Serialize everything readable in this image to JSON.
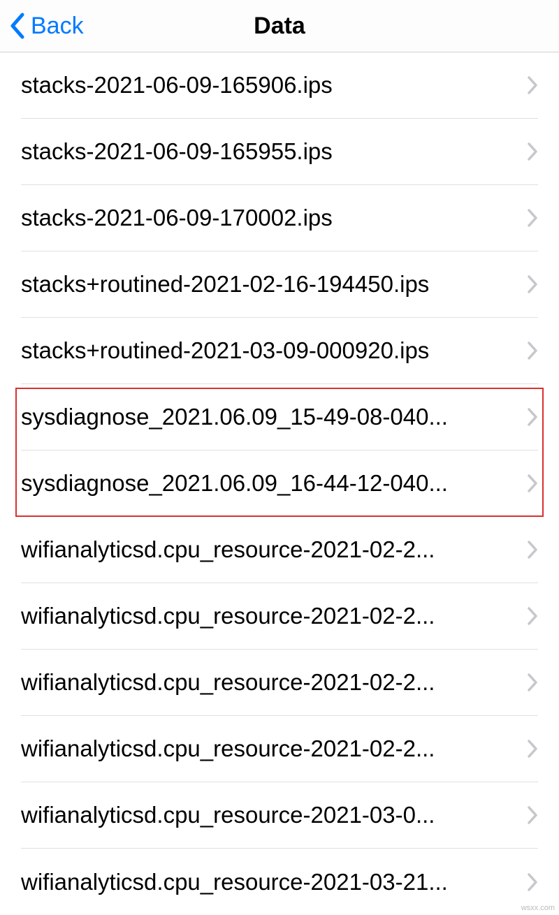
{
  "header": {
    "back_label": "Back",
    "title": "Data"
  },
  "items": [
    {
      "label": "stacks-2021-06-09-165906.ips"
    },
    {
      "label": "stacks-2021-06-09-165955.ips"
    },
    {
      "label": "stacks-2021-06-09-170002.ips"
    },
    {
      "label": "stacks+routined-2021-02-16-194450.ips"
    },
    {
      "label": "stacks+routined-2021-03-09-000920.ips"
    },
    {
      "label": "sysdiagnose_2021.06.09_15-49-08-040..."
    },
    {
      "label": "sysdiagnose_2021.06.09_16-44-12-040..."
    },
    {
      "label": "wifianalyticsd.cpu_resource-2021-02-2..."
    },
    {
      "label": "wifianalyticsd.cpu_resource-2021-02-2..."
    },
    {
      "label": "wifianalyticsd.cpu_resource-2021-02-2..."
    },
    {
      "label": "wifianalyticsd.cpu_resource-2021-02-2..."
    },
    {
      "label": "wifianalyticsd.cpu_resource-2021-03-0..."
    },
    {
      "label": "wifianalyticsd.cpu_resource-2021-03-21..."
    }
  ],
  "watermark": "wsxx.com"
}
